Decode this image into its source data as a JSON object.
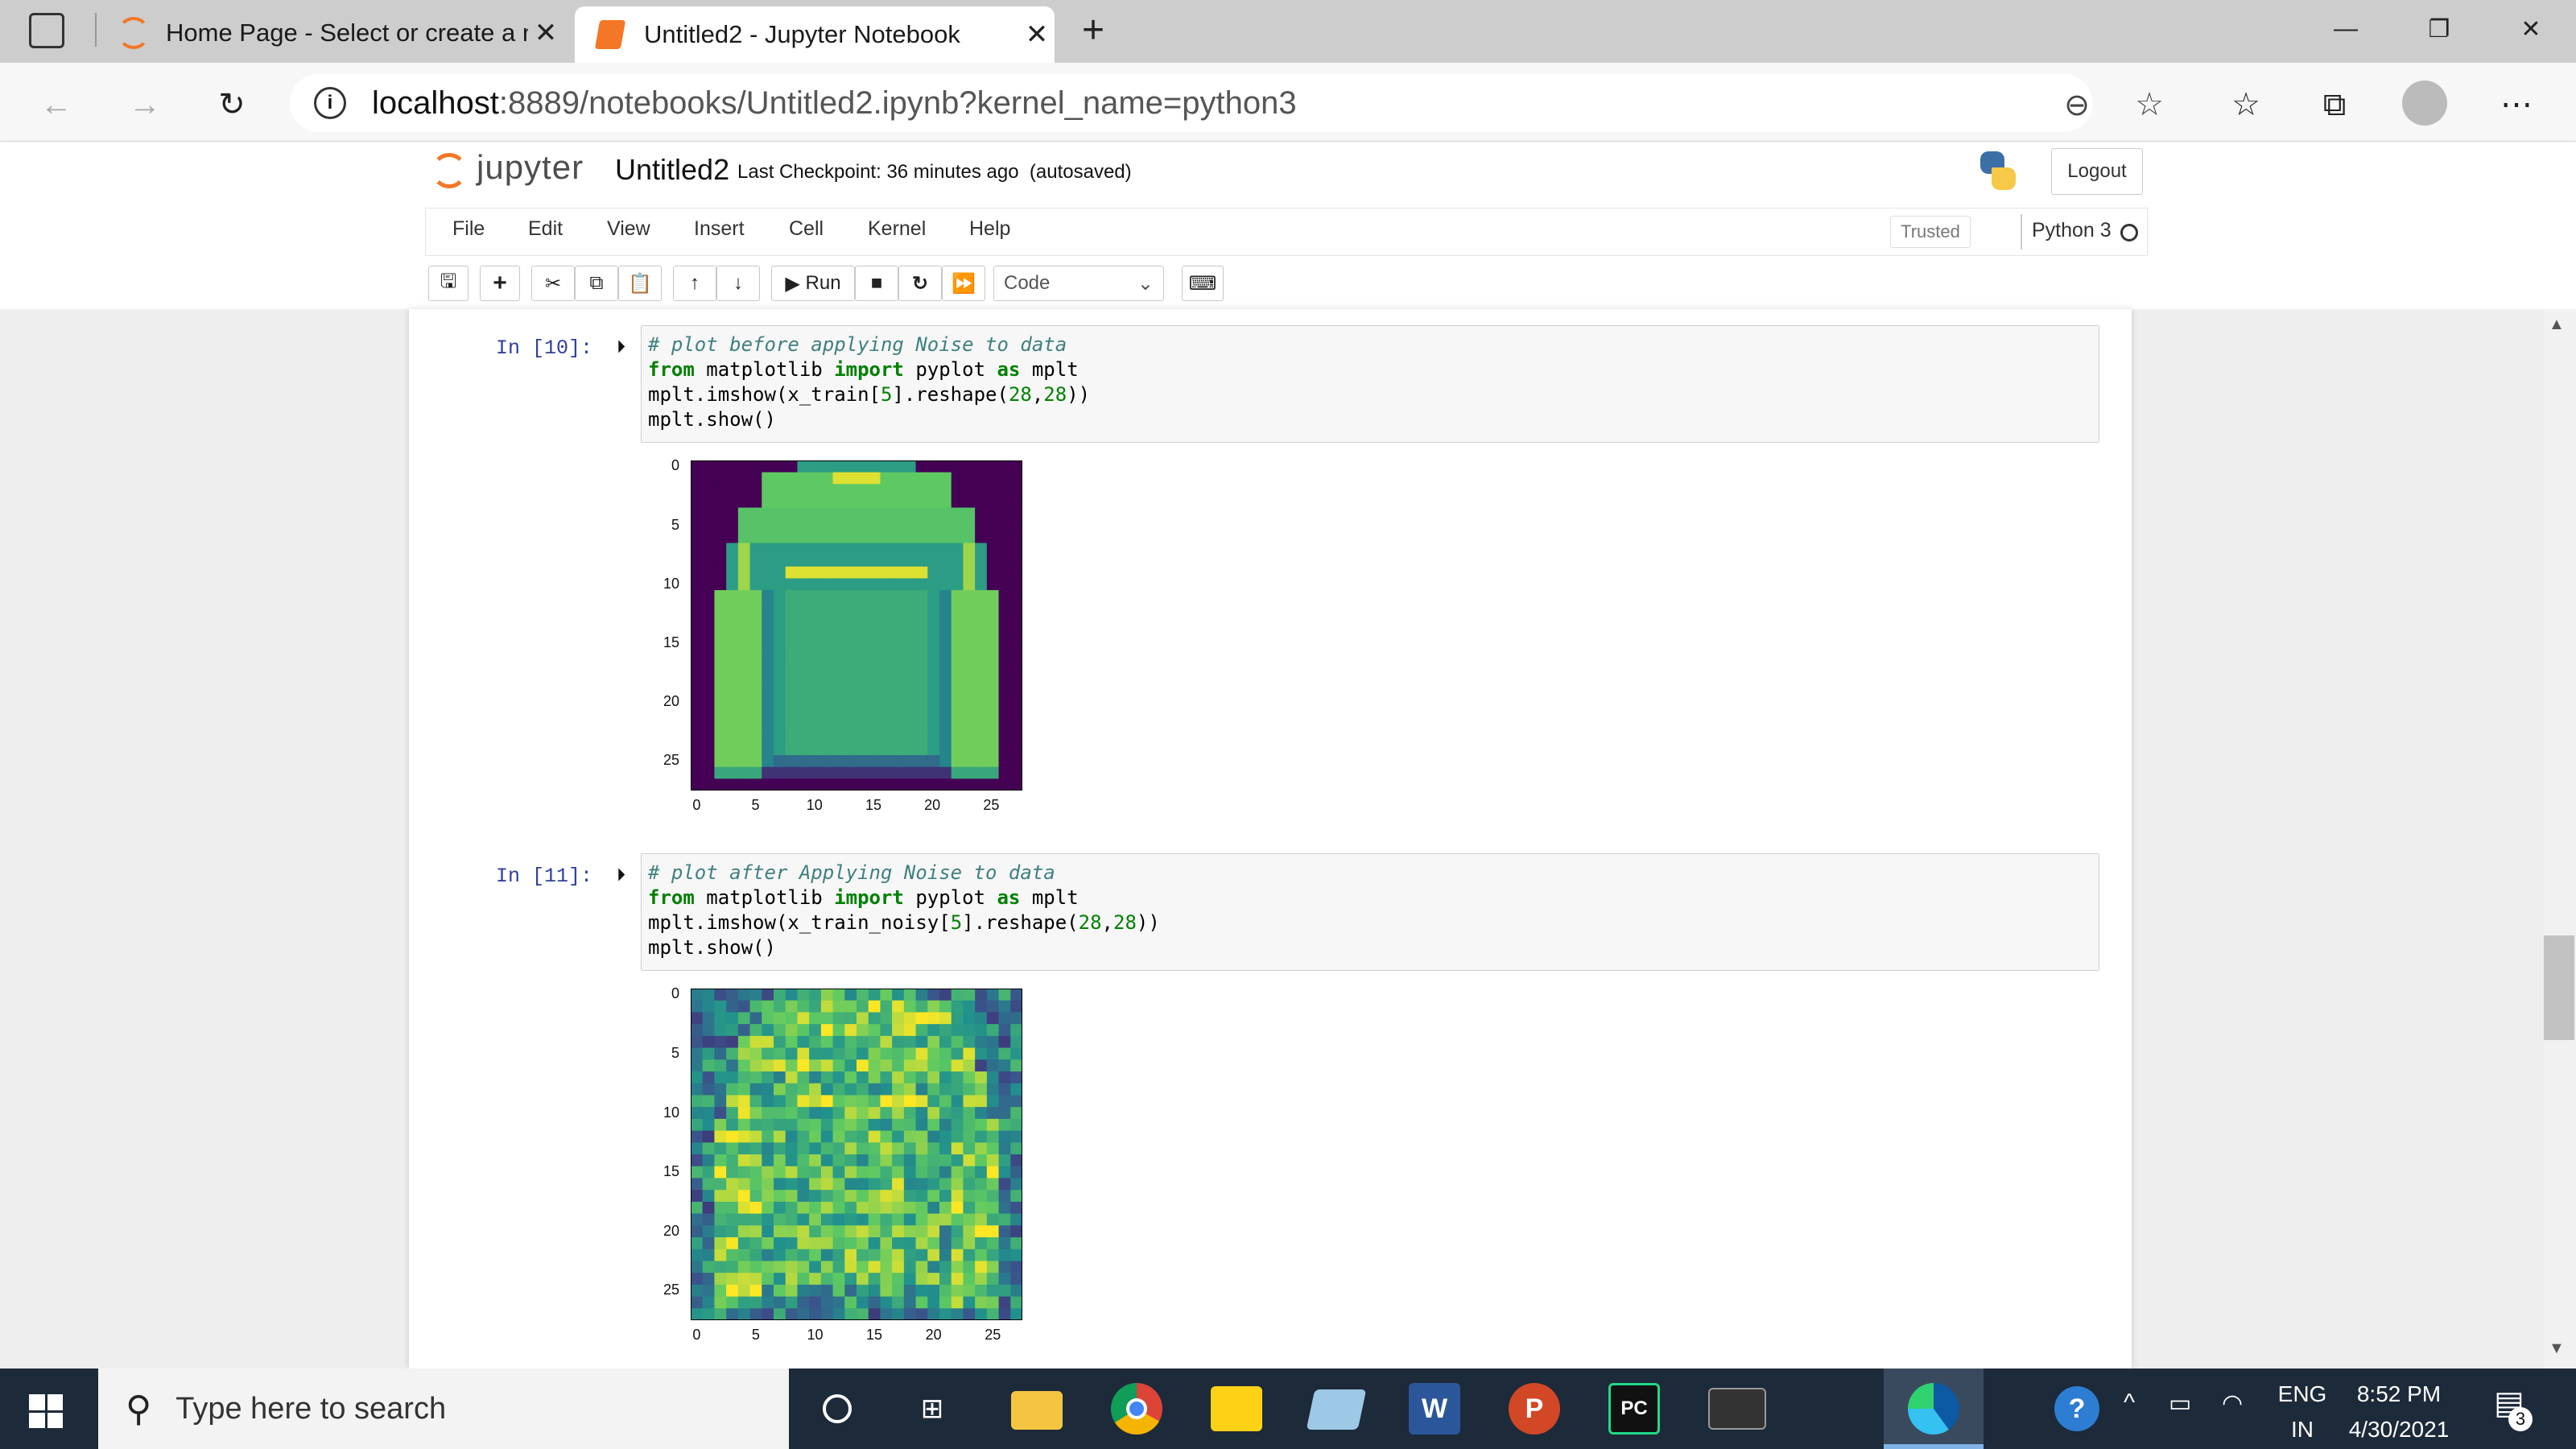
{
  "browser": {
    "tabs": [
      {
        "title": "Home Page - Select or create a n",
        "active": false
      },
      {
        "title": "Untitled2 - Jupyter Notebook",
        "active": true
      }
    ],
    "url_host": "localhost",
    "url_rest": ":8889/notebooks/Untitled2.ipynb?kernel_name=python3"
  },
  "jupyter": {
    "logo_text": "jupyter",
    "notebook_name": "Untitled2",
    "checkpoint": "Last Checkpoint: 36 minutes ago",
    "autosave": "(autosaved)",
    "logout": "Logout",
    "menu": [
      "File",
      "Edit",
      "View",
      "Insert",
      "Cell",
      "Kernel",
      "Help"
    ],
    "trusted": "Trusted",
    "kernel": "Python 3",
    "run_label": "Run",
    "cell_type": "Code"
  },
  "cells": [
    {
      "prompt": "In [10]:",
      "comment": "# plot before applying Noise to data",
      "line2": [
        "from",
        " matplotlib ",
        "import",
        " pyplot ",
        "as",
        " mplt"
      ],
      "line3_a": "mplt.imshow(x_train[",
      "line3_n1": "5",
      "line3_b": "].reshape(",
      "line3_n2": "28",
      "line3_c": ",",
      "line3_n3": "28",
      "line3_d": "))",
      "line4": "mplt.show()"
    },
    {
      "prompt": "In [11]:",
      "comment": "# plot after Applying Noise to data",
      "line2": [
        "from",
        " matplotlib ",
        "import",
        " pyplot ",
        "as",
        " mplt"
      ],
      "line3_a": "mplt.imshow(x_train_noisy[",
      "line3_n1": "5",
      "line3_b": "].reshape(",
      "line3_n2": "28",
      "line3_c": ",",
      "line3_n3": "28",
      "line3_d": "))",
      "line4": "mplt.show()"
    }
  ],
  "plot_ticks": [
    "0",
    "5",
    "10",
    "15",
    "20",
    "25"
  ],
  "taskbar": {
    "search_placeholder": "Type here to search",
    "lang": "ENG",
    "region": "IN",
    "time": "8:52 PM",
    "date": "4/30/2021",
    "notif_count": "3",
    "word_letter": "W",
    "ppt_letter": "P",
    "pycharm_letter": "PC"
  },
  "colors": {
    "accent_jupyter": "#f37726",
    "prompt_blue": "#303f9f",
    "taskbar": "#1d2a3a"
  }
}
